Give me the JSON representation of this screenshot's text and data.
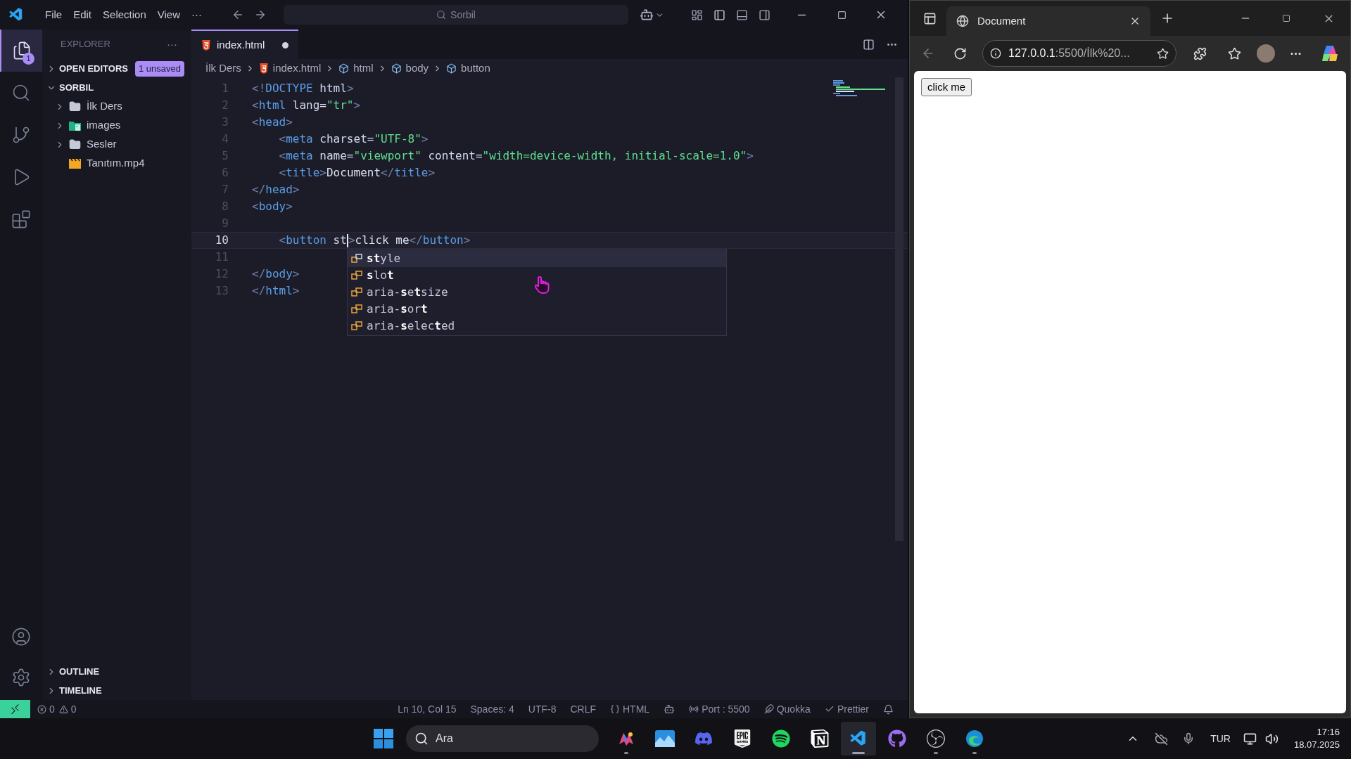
{
  "title_bar": {
    "menu": [
      "File",
      "Edit",
      "Selection",
      "View",
      "···"
    ],
    "command_center": "Sorbil"
  },
  "activity_bar": {
    "items": [
      {
        "kind": "explorer",
        "selected": true,
        "badge": "1"
      },
      {
        "kind": "search",
        "selected": false
      },
      {
        "kind": "source-control",
        "selected": false
      },
      {
        "kind": "run",
        "selected": false
      },
      {
        "kind": "extensions",
        "selected": false
      }
    ]
  },
  "sidebar": {
    "title": "EXPLORER",
    "more": "···",
    "sections": [
      {
        "label": "OPEN EDITORS",
        "expanded": false,
        "badge": "1 unsaved"
      },
      {
        "label": "SORBIL",
        "expanded": true,
        "children": [
          {
            "label": "İlk Ders",
            "kind": "folder"
          },
          {
            "label": "images",
            "kind": "image-folder"
          },
          {
            "label": "Sesler",
            "kind": "folder"
          },
          {
            "label": "Tanıtım.mp4",
            "kind": "video"
          }
        ]
      }
    ],
    "bottom_sections": [
      {
        "label": "OUTLINE",
        "expanded": false
      },
      {
        "label": "TIMELINE",
        "expanded": false
      }
    ]
  },
  "editor": {
    "tabs": [
      {
        "label": "index.html",
        "selected": true,
        "modified": true
      }
    ],
    "breadcrumb": [
      {
        "label": "İlk Ders",
        "kind": "folder"
      },
      {
        "label": "index.html",
        "kind": "html"
      },
      {
        "label": "html",
        "kind": "element"
      },
      {
        "label": "body",
        "kind": "element"
      },
      {
        "label": "button",
        "kind": "element"
      }
    ],
    "lines": [
      {
        "number": "1",
        "current": false,
        "tokens": [
          {
            "kind": "punct",
            "text": "<!"
          },
          {
            "kind": "tag",
            "text": "DOCTYPE"
          },
          {
            "kind": "attr",
            "text": " html"
          },
          {
            "kind": "punct",
            "text": ">"
          }
        ]
      },
      {
        "number": "2",
        "current": false,
        "tokens": [
          {
            "kind": "punct",
            "text": "<"
          },
          {
            "kind": "tag",
            "text": "html"
          },
          {
            "kind": "attr",
            "text": " lang="
          },
          {
            "kind": "string",
            "text": "\"tr\""
          },
          {
            "kind": "punct",
            "text": ">"
          }
        ]
      },
      {
        "number": "3",
        "current": false,
        "tokens": [
          {
            "kind": "punct",
            "text": "<"
          },
          {
            "kind": "tag",
            "text": "head"
          },
          {
            "kind": "punct",
            "text": ">"
          }
        ]
      },
      {
        "number": "4",
        "current": false,
        "tokens": [
          {
            "kind": "punct",
            "text": "    <"
          },
          {
            "kind": "tag",
            "text": "meta"
          },
          {
            "kind": "attr",
            "text": " charset="
          },
          {
            "kind": "string",
            "text": "\"UTF-8\""
          },
          {
            "kind": "punct",
            "text": ">"
          }
        ]
      },
      {
        "number": "5",
        "current": false,
        "tokens": [
          {
            "kind": "punct",
            "text": "    <"
          },
          {
            "kind": "tag",
            "text": "meta"
          },
          {
            "kind": "attr",
            "text": " name="
          },
          {
            "kind": "string",
            "text": "\"viewport\""
          },
          {
            "kind": "attr",
            "text": " content="
          },
          {
            "kind": "string",
            "text": "\"width=device-width, initial-scale=1.0\""
          },
          {
            "kind": "punct",
            "text": ">"
          }
        ]
      },
      {
        "number": "6",
        "current": false,
        "tokens": [
          {
            "kind": "punct",
            "text": "    <"
          },
          {
            "kind": "tag",
            "text": "title"
          },
          {
            "kind": "punct",
            "text": ">"
          },
          {
            "kind": "text",
            "text": "Document"
          },
          {
            "kind": "punct",
            "text": "</"
          },
          {
            "kind": "tag",
            "text": "title"
          },
          {
            "kind": "punct",
            "text": ">"
          }
        ]
      },
      {
        "number": "7",
        "current": false,
        "tokens": [
          {
            "kind": "punct",
            "text": "</"
          },
          {
            "kind": "tag",
            "text": "head"
          },
          {
            "kind": "punct",
            "text": ">"
          }
        ]
      },
      {
        "number": "8",
        "current": false,
        "tokens": [
          {
            "kind": "punct",
            "text": "<"
          },
          {
            "kind": "tag",
            "text": "body"
          },
          {
            "kind": "punct",
            "text": ">"
          }
        ]
      },
      {
        "number": "9",
        "current": false
      },
      {
        "number": "10",
        "current": true,
        "tokens": [
          {
            "kind": "punct",
            "text": "    <"
          },
          {
            "kind": "tag",
            "text": "button"
          },
          {
            "kind": "attr",
            "text": " st"
          },
          {
            "kind": "cursor"
          },
          {
            "kind": "punct",
            "text": ">"
          },
          {
            "kind": "text",
            "text": "click me"
          },
          {
            "kind": "punct",
            "text": "</"
          },
          {
            "kind": "tag",
            "text": "button"
          },
          {
            "kind": "punct",
            "text": ">"
          }
        ]
      },
      {
        "number": "11",
        "current": false
      },
      {
        "number": "12",
        "current": false,
        "tokens": [
          {
            "kind": "punct",
            "text": "</"
          },
          {
            "kind": "tag",
            "text": "body"
          },
          {
            "kind": "punct",
            "text": ">"
          }
        ]
      },
      {
        "number": "13",
        "current": false,
        "tokens": [
          {
            "kind": "punct",
            "text": "</"
          },
          {
            "kind": "tag",
            "text": "html"
          },
          {
            "kind": "punct",
            "text": ">"
          }
        ]
      }
    ],
    "suggestions": [
      {
        "label": "**st**yle",
        "selected": true
      },
      {
        "label": "**s**lo**t**",
        "selected": false
      },
      {
        "label": "aria-**s**e**t**size",
        "selected": false
      },
      {
        "label": "aria-**s**or**t**",
        "selected": false
      },
      {
        "label": "aria-**s**elec**t**ed",
        "selected": false
      }
    ]
  },
  "status_bar": {
    "errors": "0",
    "warnings": "0",
    "items": [
      {
        "kind": "plain",
        "text": "Ln 10, Col 15"
      },
      {
        "kind": "plain",
        "text": "Spaces: 4"
      },
      {
        "kind": "plain",
        "text": "UTF-8"
      },
      {
        "kind": "plain",
        "text": "CRLF"
      },
      {
        "kind": "braces",
        "text": "HTML"
      },
      {
        "kind": "copilot"
      },
      {
        "kind": "port",
        "text": "Port : 5500"
      },
      {
        "kind": "quokka",
        "text": "Quokka"
      },
      {
        "kind": "prettier",
        "text": "Prettier"
      },
      {
        "kind": "bell"
      }
    ]
  },
  "browser": {
    "tab": {
      "title": "Document",
      "selected": true
    },
    "url_host": "127.0.0.1",
    "url_rest": ":5500/İlk%20...",
    "page": {
      "button": "click me"
    }
  },
  "taskbar": {
    "search": "Ara",
    "apps": [
      {
        "kind": "copilot",
        "running": true,
        "active": false
      },
      {
        "kind": "photos",
        "running": false,
        "active": false
      },
      {
        "kind": "discord",
        "running": false,
        "active": false
      },
      {
        "kind": "epic",
        "running": false,
        "active": false
      },
      {
        "kind": "spotify",
        "running": false,
        "active": false
      },
      {
        "kind": "notion",
        "running": false,
        "active": false
      },
      {
        "kind": "vscode",
        "running": true,
        "active": true
      },
      {
        "kind": "github",
        "running": false,
        "active": false
      },
      {
        "kind": "obs",
        "running": true,
        "active": false
      },
      {
        "kind": "edge",
        "running": true,
        "active": false
      }
    ],
    "language": "TUR",
    "time": "17:16",
    "date": "18.07.2025"
  }
}
